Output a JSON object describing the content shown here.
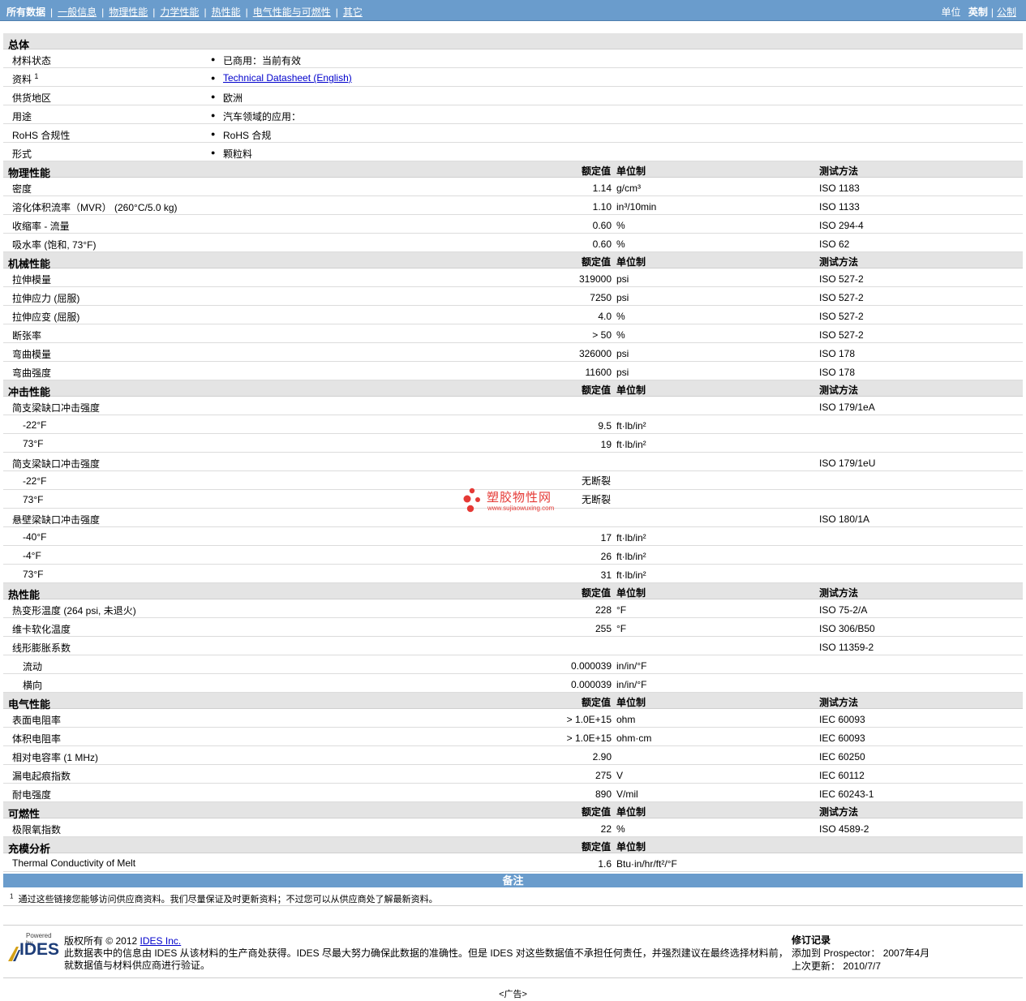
{
  "nav": {
    "items": [
      "所有数据",
      "一般信息",
      "物理性能",
      "力学性能",
      "热性能",
      "电气性能与可燃性",
      "其它"
    ],
    "units_label": "单位",
    "unit_current": "英制",
    "unit_other": "公制"
  },
  "col_headers": {
    "value": "额定值",
    "unit": "单位制",
    "method": "测试方法"
  },
  "general": {
    "title": "总体",
    "rows": [
      {
        "label": "材料状态",
        "value": "已商用：当前有效"
      },
      {
        "label": "资料",
        "sup": "1",
        "link": "Technical Datasheet (English)"
      },
      {
        "label": "供货地区",
        "value": "欧洲"
      },
      {
        "label": "用途",
        "value": "汽车领域的应用："
      },
      {
        "label": "RoHS 合规性",
        "value": "RoHS 合规"
      },
      {
        "label": "形式",
        "value": "颗粒料"
      }
    ]
  },
  "sections": [
    {
      "title": "物理性能",
      "rows": [
        {
          "label": "密度",
          "value": "1.14",
          "unit": "g/cm³",
          "method": "ISO 1183"
        },
        {
          "label": "溶化体积流率（MVR）  (260°C/5.0 kg)",
          "value": "1.10",
          "unit": "in³/10min",
          "method": "ISO 1133"
        },
        {
          "label": "收缩率  - 流量",
          "value": "0.60",
          "unit": "%",
          "method": "ISO 294-4"
        },
        {
          "label": "吸水率 (饱和, 73°F)",
          "value": "0.60",
          "unit": "%",
          "method": "ISO 62"
        }
      ]
    },
    {
      "title": "机械性能",
      "rows": [
        {
          "label": "拉伸模量",
          "value": "319000",
          "unit": "psi",
          "method": "ISO 527-2"
        },
        {
          "label": "拉伸应力 (屈服)",
          "value": "7250",
          "unit": "psi",
          "method": "ISO 527-2"
        },
        {
          "label": "拉伸应变 (屈服)",
          "value": "4.0",
          "unit": "%",
          "method": "ISO 527-2"
        },
        {
          "label": "断张率",
          "value": "> 50",
          "unit": "%",
          "method": "ISO 527-2"
        },
        {
          "label": "弯曲模量",
          "value": "326000",
          "unit": "psi",
          "method": "ISO 178"
        },
        {
          "label": "弯曲强度",
          "value": "11600",
          "unit": "psi",
          "method": "ISO 178"
        }
      ]
    },
    {
      "title": "冲击性能",
      "rows": [
        {
          "label": "简支梁缺口冲击强度",
          "value": "",
          "unit": "",
          "method": "ISO 179/1eA"
        },
        {
          "label": "-22°F",
          "sub": true,
          "value": "9.5",
          "unit": "ft·lb/in²",
          "method": ""
        },
        {
          "label": "73°F",
          "sub": true,
          "value": "19",
          "unit": "ft·lb/in²",
          "method": ""
        },
        {
          "label": "简支梁缺口冲击强度",
          "value": "",
          "unit": "",
          "method": "ISO 179/1eU"
        },
        {
          "label": "-22°F",
          "sub": true,
          "value": "无断裂",
          "text": true,
          "unit": "",
          "method": ""
        },
        {
          "label": "73°F",
          "sub": true,
          "value": "无断裂",
          "text": true,
          "unit": "",
          "method": ""
        },
        {
          "label": "悬壁梁缺口冲击强度",
          "value": "",
          "unit": "",
          "method": "ISO 180/1A"
        },
        {
          "label": "-40°F",
          "sub": true,
          "value": "17",
          "unit": "ft·lb/in²",
          "method": ""
        },
        {
          "label": "-4°F",
          "sub": true,
          "value": "26",
          "unit": "ft·lb/in²",
          "method": ""
        },
        {
          "label": "73°F",
          "sub": true,
          "value": "31",
          "unit": "ft·lb/in²",
          "method": ""
        }
      ]
    },
    {
      "title": "热性能",
      "rows": [
        {
          "label": "热变形温度 (264 psi, 未退火)",
          "value": "228",
          "unit": "°F",
          "method": "ISO 75-2/A"
        },
        {
          "label": "维卡软化温度",
          "value": "255",
          "unit": "°F",
          "method": "ISO 306/B50"
        },
        {
          "label": "线形膨胀系数",
          "value": "",
          "unit": "",
          "method": "ISO 11359-2"
        },
        {
          "label": "流动",
          "sub": true,
          "value": "0.000039",
          "unit": "in/in/°F",
          "method": ""
        },
        {
          "label": "横向",
          "sub": true,
          "value": "0.000039",
          "unit": "in/in/°F",
          "method": ""
        }
      ]
    },
    {
      "title": "电气性能",
      "rows": [
        {
          "label": "表面电阻率",
          "value": "> 1.0E+15",
          "unit": "ohm",
          "method": "IEC 60093"
        },
        {
          "label": "体积电阻率",
          "value": "> 1.0E+15",
          "unit": "ohm·cm",
          "method": "IEC 60093"
        },
        {
          "label": "相对电容率 (1 MHz)",
          "value": "2.90",
          "unit": "",
          "method": "IEC 60250"
        },
        {
          "label": "漏电起痕指数",
          "value": "275",
          "unit": "V",
          "method": "IEC 60112"
        },
        {
          "label": "耐电强度",
          "value": "890",
          "unit": "V/mil",
          "method": "IEC 60243-1"
        }
      ]
    },
    {
      "title": "可燃性",
      "rows": [
        {
          "label": "极限氧指数",
          "value": "22",
          "unit": "%",
          "method": "ISO 4589-2"
        }
      ]
    },
    {
      "title": "充模分析",
      "no_method": true,
      "rows": [
        {
          "label": "Thermal Conductivity of Melt",
          "value": "1.6",
          "unit": "Btu·in/hr/ft²/°F",
          "method": ""
        }
      ]
    }
  ],
  "watermark": {
    "cn": "塑胶物性网",
    "en": "www.sujiaowuxing.com"
  },
  "notes": {
    "title": "备注",
    "sup": "1",
    "text": "通过这些链接您能够访问供应商资料。我们尽量保证及时更新资料；不过您可以从供应商处了解最新资料。"
  },
  "footer": {
    "powered_by": "Powered by",
    "brand": "IDES",
    "copyright_prefix": "版权所有  © 2012 ",
    "copyright_link": "IDES Inc.",
    "disclaimer_1": "此数据表中的信息由  IDES 从该材料的生产商处获得。IDES 尽最大努力确保此数据的准确性。但是  IDES 对这些数据值不承担任何责任，并强烈建议在最终选择材料前，",
    "disclaimer_2": "就数据值与材料供应商进行验证。",
    "rev_title": "修订记录",
    "rev_added": "添加到  Prospector：  2007年4月",
    "rev_updated": "上次更新：  2010/7/7"
  },
  "ad": "<广告>"
}
